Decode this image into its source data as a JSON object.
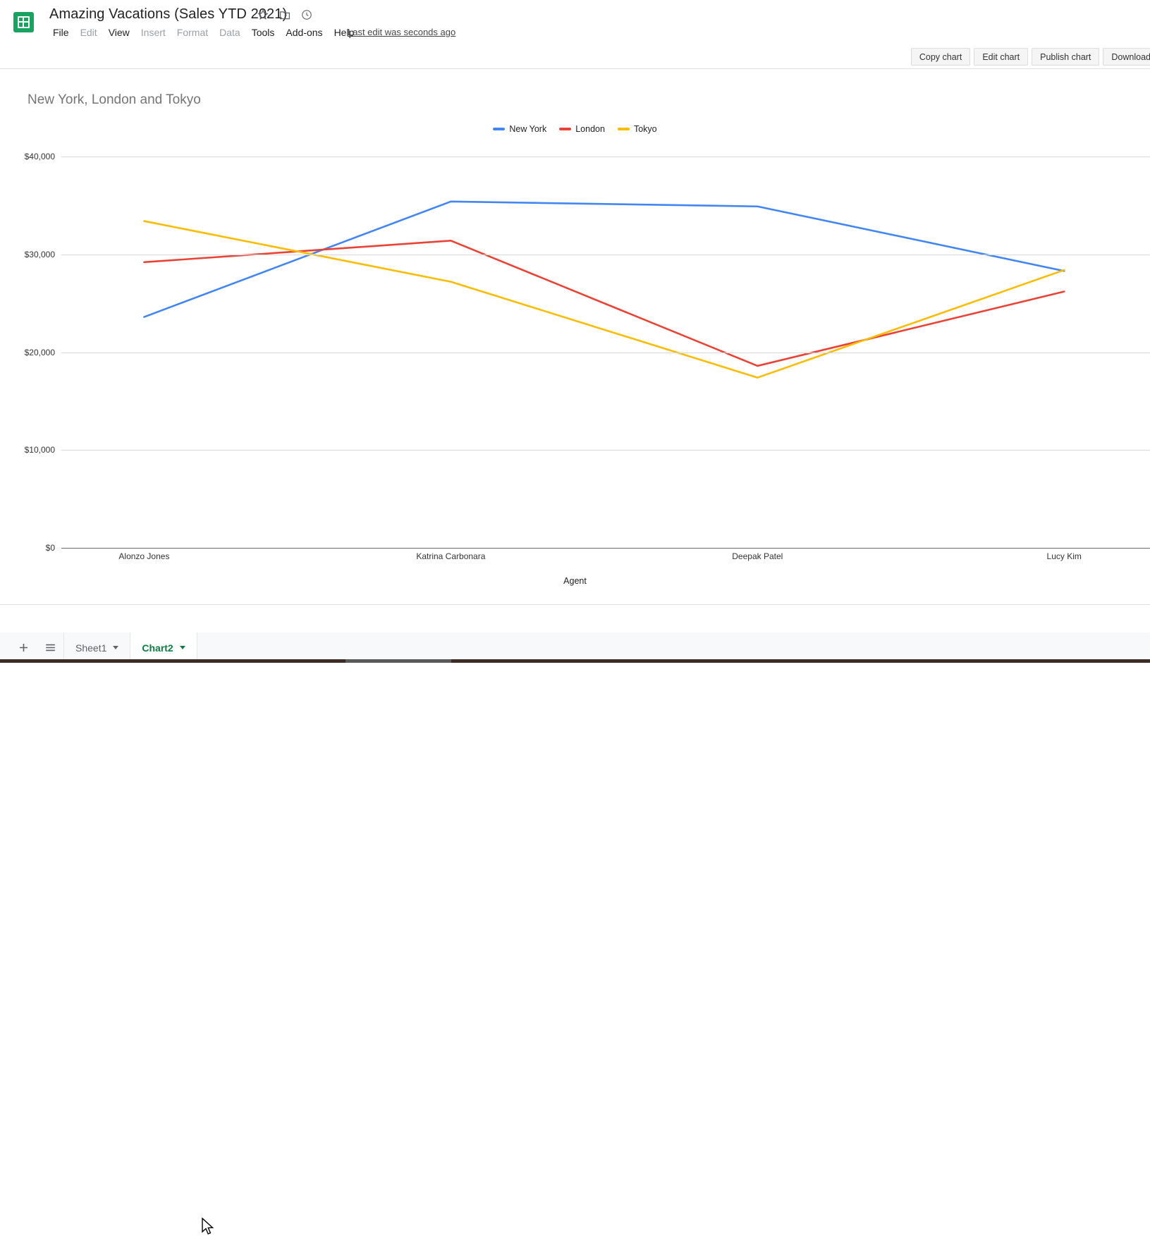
{
  "titlebar": {
    "doc_title": "Amazing Vacations (Sales YTD 2021)",
    "icons": [
      {
        "name": "star-icon",
        "glyph": "☆"
      },
      {
        "name": "move-to-folder-icon",
        "glyph": "▣"
      },
      {
        "name": "cloud-saved-icon",
        "glyph": "☁"
      }
    ],
    "menus": [
      {
        "label": "File",
        "dim": false
      },
      {
        "label": "Edit",
        "dim": true
      },
      {
        "label": "View",
        "dim": false
      },
      {
        "label": "Insert",
        "dim": true
      },
      {
        "label": "Format",
        "dim": true
      },
      {
        "label": "Data",
        "dim": true
      },
      {
        "label": "Tools",
        "dim": false
      },
      {
        "label": "Add-ons",
        "dim": false
      },
      {
        "label": "Help",
        "dim": false
      }
    ],
    "last_edit": "Last edit was seconds ago"
  },
  "toolbar": {
    "buttons": [
      {
        "label": "Copy chart"
      },
      {
        "label": "Edit chart"
      },
      {
        "label": "Publish chart"
      },
      {
        "label": "Download"
      }
    ]
  },
  "chart_data": {
    "type": "line",
    "title": "New York, London and Tokyo",
    "xlabel": "Agent",
    "ylabel": "",
    "categories": [
      "Alonzo Jones",
      "Katrina Carbonara",
      "Deepak Patel",
      "Lucy Kim"
    ],
    "ytick_labels": [
      "$40,000",
      "$30,000",
      "$20,000",
      "$10,000",
      "$0"
    ],
    "ytick_values": [
      40000,
      30000,
      20000,
      10000,
      0
    ],
    "ylim": [
      0,
      42000
    ],
    "grid": true,
    "legend_position": "top-center",
    "series": [
      {
        "name": "New York",
        "color": "#4285f4",
        "values": [
          23600,
          35400,
          34900,
          28300
        ]
      },
      {
        "name": "London",
        "color": "#ea4335",
        "values": [
          29200,
          31400,
          18600,
          26200
        ]
      },
      {
        "name": "Tokyo",
        "color": "#fbbc04",
        "values": [
          33400,
          27200,
          17400,
          28400
        ]
      }
    ]
  },
  "sheetbar": {
    "add_sheet_label": "+",
    "all_sheets_label": "≡",
    "tabs": [
      {
        "label": "Sheet1",
        "active": false
      },
      {
        "label": "Chart2",
        "active": true
      }
    ]
  }
}
